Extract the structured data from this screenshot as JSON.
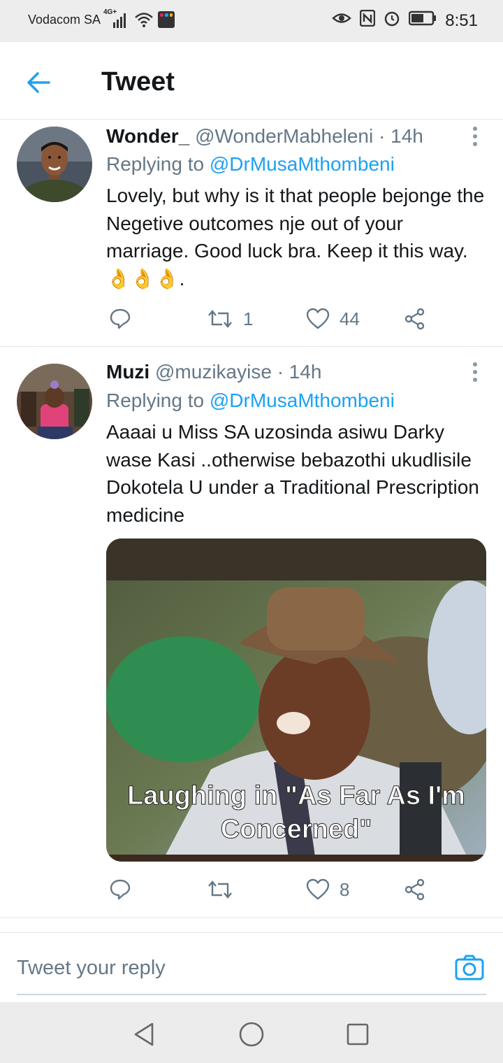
{
  "status_bar": {
    "carrier": "Vodacom SA",
    "network": "4G+",
    "time": "8:51"
  },
  "header": {
    "title": "Tweet",
    "back_icon": "arrow-left-icon"
  },
  "tweets": [
    {
      "name": "Wonder_",
      "handle": "@WonderMabheleni",
      "time": "· 14h",
      "replying_prefix": "Replying to ",
      "replying_to": "@DrMusaMthombeni",
      "text": "Lovely, but why is it that people bejonge the Negetive outcomes nje out of your marriage. Good luck bra. Keep it this way. 👌👌👌.",
      "retweets": "1",
      "likes": "44"
    },
    {
      "name": "Muzi",
      "handle": "@muzikayise",
      "time": "· 14h",
      "replying_prefix": "Replying to ",
      "replying_to": "@DrMusaMthombeni",
      "text": "Aaaai u Miss SA uzosinda asiwu Darky wase Kasi ..otherwise bebazothi ukudlisile Dokotela U under a Traditional Prescription medicine",
      "media_caption_line1": "Laughing in \"As Far As I'm",
      "media_caption_line2": "Concerned\"",
      "retweets": "",
      "likes": "8"
    }
  ],
  "reply": {
    "placeholder": "Tweet your reply"
  },
  "colors": {
    "accent": "#1da1f2",
    "secondary_text": "#657786",
    "primary_text": "#14171a"
  }
}
